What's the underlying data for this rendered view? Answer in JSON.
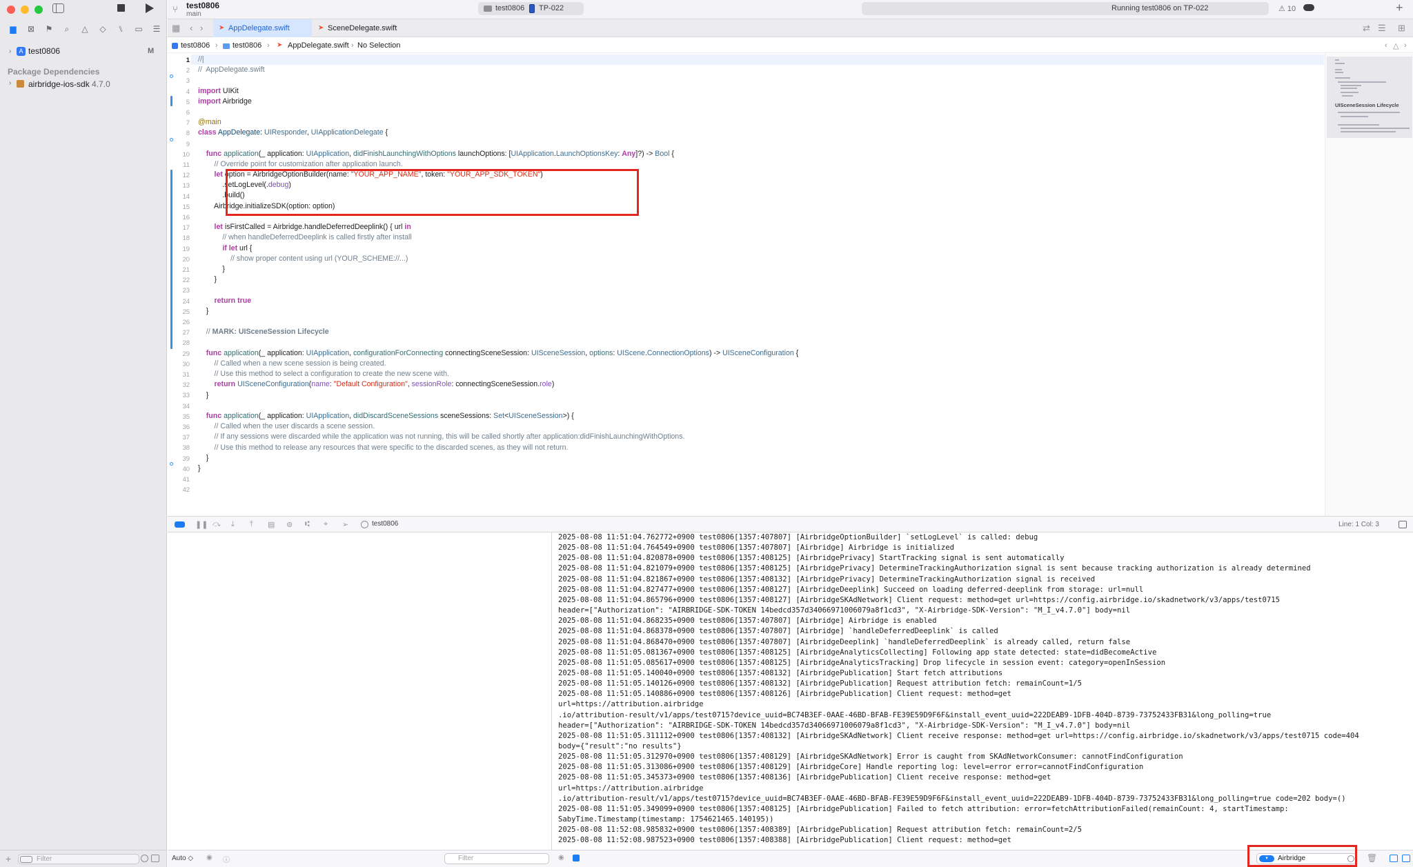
{
  "window": {
    "project_title": "test0806",
    "branch": "main"
  },
  "toolbar": {
    "scheme": "test0806",
    "device": "TP-022",
    "status": "Running test0806 on TP-022",
    "warnings": "⚠ 10",
    "plus": "+"
  },
  "sidebar": {
    "project": "test0806",
    "project_status": "M",
    "package_header": "Package Dependencies",
    "package_name": "airbridge-ios-sdk",
    "package_version": "4.7.0",
    "filter_placeholder": "Filter"
  },
  "tabs": [
    {
      "label": "AppDelegate.swift"
    },
    {
      "label": "SceneDelegate.swift"
    }
  ],
  "jumpbar": {
    "project": "test0806",
    "folder": "test0806",
    "file": "AppDelegate.swift",
    "selection": "No Selection"
  },
  "editor": {
    "current_line": "1",
    "line_numbers": [
      "1",
      "2",
      "3",
      "4",
      "5",
      "6",
      "7",
      "8",
      "9",
      "10",
      "11",
      "12",
      "13",
      "14",
      "15",
      "16",
      "17",
      "18",
      "19",
      "20",
      "21",
      "22",
      "23",
      "24",
      "25",
      "26",
      "27",
      "28",
      "29",
      "30",
      "31",
      "32",
      "33",
      "34",
      "35",
      "36",
      "37",
      "38",
      "39",
      "40",
      "41",
      "42"
    ]
  },
  "minimap": {
    "label": "UISceneSession Lifecycle"
  },
  "debugbar": {
    "process": "test0806",
    "line_col": "Line: 1  Col: 3"
  },
  "console": {
    "lines": [
      "2025-08-08 11:51:04.762772+0900 test0806[1357:407807] [AirbridgeOptionBuilder] `setLogLevel` is called: debug",
      "2025-08-08 11:51:04.764549+0900 test0806[1357:407807] [Airbridge] Airbridge is initialized",
      "2025-08-08 11:51:04.820878+0900 test0806[1357:408125] [AirbridgePrivacy] StartTracking signal is sent automatically",
      "2025-08-08 11:51:04.821079+0900 test0806[1357:408125] [AirbridgePrivacy] DetermineTrackingAuthorization signal is sent because tracking authorization is already determined",
      "2025-08-08 11:51:04.821867+0900 test0806[1357:408132] [AirbridgePrivacy] DetermineTrackingAuthorization signal is received",
      "2025-08-08 11:51:04.827477+0900 test0806[1357:408127] [AirbridgeDeeplink] Succeed on loading deferred-deeplink from storage: url=null",
      "2025-08-08 11:51:04.865796+0900 test0806[1357:408127] [AirbridgeSKAdNetwork] Client request: method=get url=https://config.airbridge.io/skadnetwork/v3/apps/test0715",
      "header=[\"Authorization\": \"AIRBRIDGE-SDK-TOKEN 14bedcd357d34066971006079a8f1cd3\", \"X-Airbridge-SDK-Version\": \"M_I_v4.7.0\"] body=nil",
      "2025-08-08 11:51:04.868235+0900 test0806[1357:407807] [Airbridge] Airbridge is enabled",
      "2025-08-08 11:51:04.868378+0900 test0806[1357:407807] [Airbridge] `handleDeferredDeeplink` is called",
      "2025-08-08 11:51:04.868470+0900 test0806[1357:407807] [AirbridgeDeeplink] `handleDeferredDeeplink` is already called, return false",
      "2025-08-08 11:51:05.081367+0900 test0806[1357:408125] [AirbridgeAnalyticsCollecting] Following app state detected: state=didBecomeActive",
      "2025-08-08 11:51:05.085617+0900 test0806[1357:408125] [AirbridgeAnalyticsTracking] Drop lifecycle in session event: category=openInSession",
      "2025-08-08 11:51:05.140040+0900 test0806[1357:408132] [AirbridgePublication] Start fetch attributions",
      "2025-08-08 11:51:05.140126+0900 test0806[1357:408132] [AirbridgePublication] Request attribution fetch: remainCount=1/5",
      "2025-08-08 11:51:05.140886+0900 test0806[1357:408126] [AirbridgePublication] Client request: method=get",
      "url=https://attribution.airbridge",
      ".io/attribution-result/v1/apps/test0715?device_uuid=BC74B3EF-0AAE-46BD-BFAB-FE39E59D9F6F&install_event_uuid=222DEAB9-1DFB-404D-8739-73752433FB31&long_polling=true",
      "header=[\"Authorization\": \"AIRBRIDGE-SDK-TOKEN 14bedcd357d34066971006079a8f1cd3\", \"X-Airbridge-SDK-Version\": \"M_I_v4.7.0\"] body=nil",
      "2025-08-08 11:51:05.311112+0900 test0806[1357:408132] [AirbridgeSKAdNetwork] Client receive response: method=get url=https://config.airbridge.io/skadnetwork/v3/apps/test0715 code=404",
      "body={\"result\":\"no results\"}",
      "2025-08-08 11:51:05.312970+0900 test0806[1357:408129] [AirbridgeSKAdNetwork] Error is caught from SKAdNetworkConsumer: cannotFindConfiguration",
      "2025-08-08 11:51:05.313086+0900 test0806[1357:408129] [AirbridgeCore] Handle reporting log: level=error error=cannotFindConfiguration",
      "2025-08-08 11:51:05.345373+0900 test0806[1357:408136] [AirbridgePublication] Client receive response: method=get",
      "url=https://attribution.airbridge",
      ".io/attribution-result/v1/apps/test0715?device_uuid=BC74B3EF-0AAE-46BD-BFAB-FE39E59D9F6F&install_event_uuid=222DEAB9-1DFB-404D-8739-73752433FB31&long_polling=true code=202 body=()",
      "2025-08-08 11:51:05.349099+0900 test0806[1357:408125] [AirbridgePublication] Failed to fetch attribution: error=fetchAttributionFailed(remainCount: 4, startTimestamp:",
      "SabyTime.Timestamp(timestamp: 1754621465.140195))",
      "2025-08-08 11:52:08.985832+0900 test0806[1357:408389] [AirbridgePublication] Request attribution fetch: remainCount=2/5",
      "2025-08-08 11:52:08.987523+0900 test0806[1357:408388] [AirbridgePublication] Client request: method=get"
    ]
  },
  "bottombar": {
    "auto": "Auto ◇",
    "vars_filter_placeholder": "Filter",
    "console_filter_value": "Airbridge"
  },
  "icons": [
    "sidebar-toggle-icon",
    "stop-icon",
    "run-icon",
    "branch-icon",
    "folder-icon",
    "swift-file-icon",
    "package-icon",
    "trash-icon",
    "filter-icon"
  ]
}
